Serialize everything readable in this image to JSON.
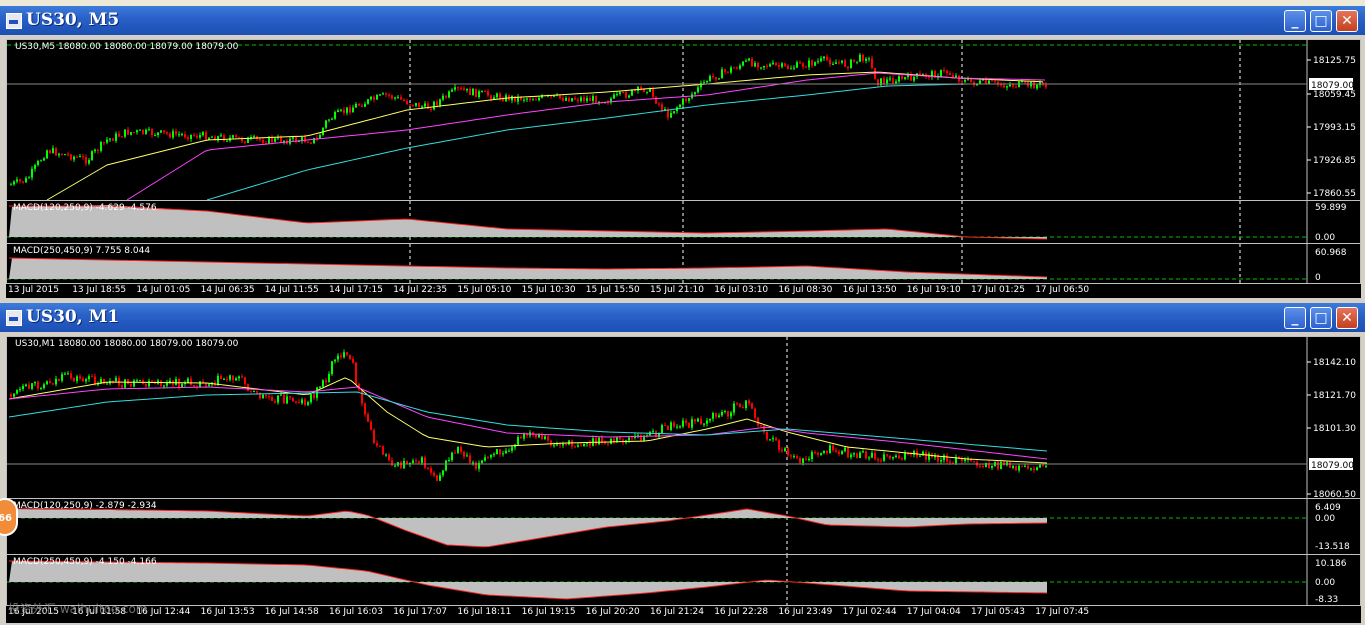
{
  "windows": [
    {
      "title": "US30, M5",
      "header": "US30,M5  18080.00 18080.00 18079.00 18079.00",
      "price_ticks": [
        "18125.75",
        "18059.45",
        "17993.15",
        "17926.85",
        "17860.55"
      ],
      "price_current": "18079.00",
      "macd1": {
        "label": "MACD(120,250,9) -4.629 -4.576",
        "ticks": [
          "59.899",
          "0.00"
        ]
      },
      "macd2": {
        "label": "MACD(250,450,9) 7.755 8.044",
        "ticks": [
          "60.968",
          "0"
        ]
      },
      "time_ticks": [
        "13 Jul 2015",
        "13 Jul 18:55",
        "14 Jul 01:05",
        "14 Jul 06:35",
        "14 Jul 11:55",
        "14 Jul 17:15",
        "14 Jul 22:35",
        "15 Jul 05:10",
        "15 Jul 10:30",
        "15 Jul 15:50",
        "15 Jul 21:10",
        "16 Jul 03:10",
        "16 Jul 08:30",
        "16 Jul 13:50",
        "16 Jul 19:10",
        "17 Jul 01:25",
        "17 Jul 06:50"
      ]
    },
    {
      "title": "US30, M1",
      "header": "US30,M1  18080.00 18080.00 18079.00 18079.00",
      "price_ticks": [
        "18142.10",
        "18121.70",
        "18101.30",
        "18060.50"
      ],
      "price_current": "18079.00",
      "macd1": {
        "label": "MACD(120,250,9) -2.879 -2.934",
        "ticks": [
          "6.409",
          "0.00",
          "-13.518"
        ]
      },
      "macd2": {
        "label": "MACD(250,450,9) -4.150 -4.166",
        "ticks": [
          "10.186",
          "0.00",
          "-8.33"
        ]
      },
      "time_ticks": [
        "16 Jul 2015",
        "16 Jul 11:58",
        "16 Jul 12:44",
        "16 Jul 13:53",
        "16 Jul 14:58",
        "16 Jul 16:03",
        "16 Jul 17:07",
        "16 Jul 18:11",
        "16 Jul 19:15",
        "16 Jul 20:20",
        "16 Jul 21:24",
        "16 Jul 22:28",
        "16 Jul 23:49",
        "17 Jul 02:44",
        "17 Jul 04:04",
        "17 Jul 05:43",
        "17 Jul 07:45"
      ]
    }
  ],
  "badge": "66",
  "watermark": "投资外汇 waihuitoo.com",
  "colors": {
    "bull": "#00ff00",
    "bear": "#ff0000",
    "ma_fast": "#ffff66",
    "ma_mid": "#ff44ff",
    "ma_slow": "#33dddd",
    "hist": "#c0c0c0",
    "signal": "#ff2020",
    "grid": "#ffffff",
    "dash": "#00c000"
  }
}
